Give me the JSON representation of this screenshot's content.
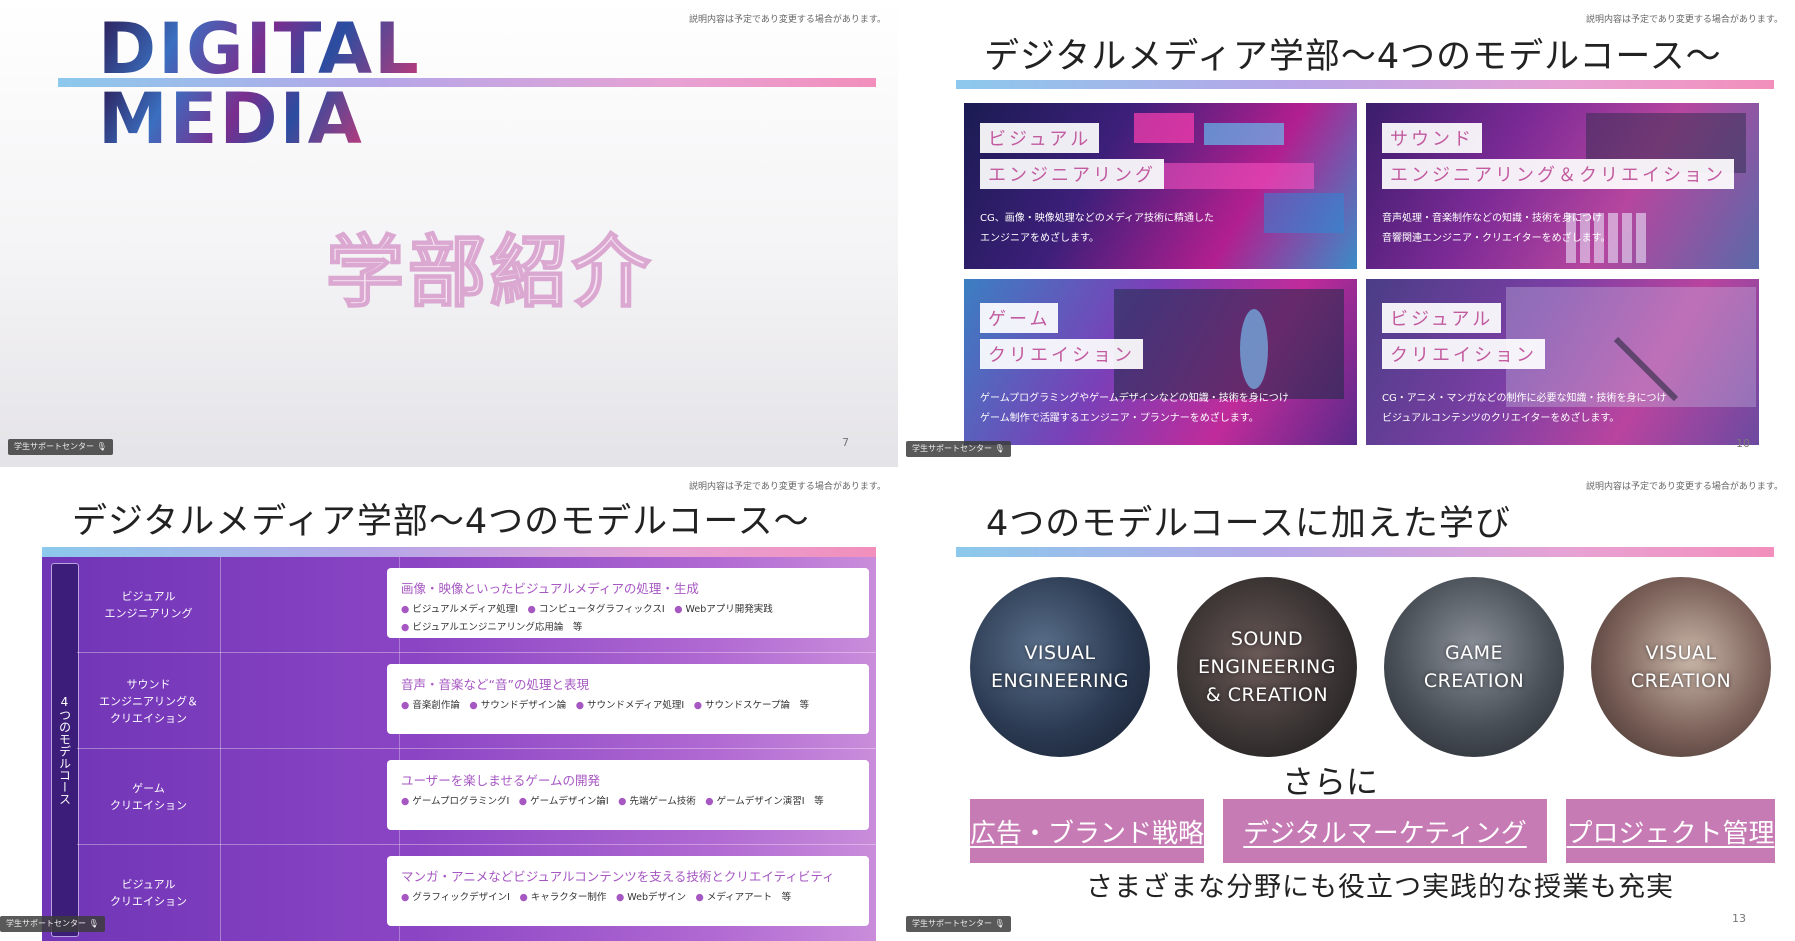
{
  "disclaimer": "説明内容は予定であり変更する場合があります。",
  "caption_label": "学生サポートセンター",
  "slide1": {
    "logo_line1": "DIGITAL",
    "logo_line2": "MEDIA",
    "title": "学部紹介",
    "page": "7"
  },
  "slide2": {
    "title": "デジタルメディア学部〜4つのモデルコース〜",
    "page": "10",
    "cards": [
      {
        "tag1": "ビジュアル",
        "tag2": "エンジニアリング",
        "desc1": "CG、画像・映像処理などのメディア技術に精通した",
        "desc2": "エンジニアをめざします。"
      },
      {
        "tag1": "サウンド",
        "tag2": "エンジニアリング＆クリエイション",
        "desc1": "音声処理・音楽制作などの知識・技術を身につけ",
        "desc2": "音響関連エンジニア・クリエイターをめざします。"
      },
      {
        "tag1": "ゲーム",
        "tag2": "クリエイション",
        "desc1": "ゲームプログラミングやゲームデザインなどの知識・技術を身につけ",
        "desc2": "ゲーム制作で活躍するエンジニア・プランナーをめざします。"
      },
      {
        "tag1": "ビジュアル",
        "tag2": "クリエイション",
        "desc1": "CG・アニメ・マンガなどの制作に必要な知識・技術を身につけ",
        "desc2": "ビジュアルコンテンツのクリエイターをめざします。"
      }
    ]
  },
  "slide3": {
    "title": "デジタルメディア学部〜4つのモデルコース〜",
    "side_label": "4つのモデルコース",
    "rows": [
      {
        "label1": "ビジュアル",
        "label2": "エンジニアリング",
        "heading": "画像・映像といったビジュアルメディアの処理・生成",
        "items": [
          "ビジュアルメディア処理Ⅰ",
          "コンピュータグラフィックスⅠ",
          "Webアプリ開発実践",
          "ビジュアルエンジニアリング応用論　等"
        ]
      },
      {
        "label1": "サウンド",
        "label2": "エンジニアリング＆",
        "label3": "クリエイション",
        "heading": "音声・音楽など“音”の処理と表現",
        "items": [
          "音楽創作論",
          "サウンドデザイン論",
          "サウンドメディア処理Ⅰ",
          "サウンドスケープ論　等"
        ]
      },
      {
        "label1": "ゲーム",
        "label2": "クリエイション",
        "heading": "ユーザーを楽しませるゲームの開発",
        "items": [
          "ゲームプログラミングⅠ",
          "ゲームデザイン論Ⅰ",
          "先端ゲーム技術",
          "ゲームデザイン演習Ⅰ　等"
        ]
      },
      {
        "label1": "ビジュアル",
        "label2": "クリエイション",
        "heading": "マンガ・アニメなどビジュアルコンテンツを支える技術とクリエイティビティ",
        "items": [
          "グラフィックデザインⅠ",
          "キャラクター制作",
          "Webデザイン",
          "メディアアート　等"
        ]
      }
    ]
  },
  "slide4": {
    "title": "4つのモデルコースに加えた学び",
    "page": "13",
    "circles": [
      {
        "line1": "VISUAL",
        "line2": "ENGINEERING",
        "line3": ""
      },
      {
        "line1": "SOUND",
        "line2": "ENGINEERING",
        "line3": "& CREATION"
      },
      {
        "line1": "GAME",
        "line2": "CREATION",
        "line3": ""
      },
      {
        "line1": "VISUAL",
        "line2": "CREATION",
        "line3": ""
      }
    ],
    "sarani": "さらに",
    "pills": [
      "広告・ブランド戦略",
      "デジタルマーケティング",
      "プロジェクト管理"
    ],
    "footer": "さまざまな分野にも役立つ実践的な授業も充実"
  }
}
